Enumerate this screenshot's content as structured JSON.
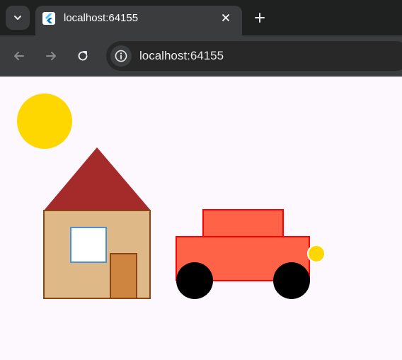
{
  "browser": {
    "tab": {
      "title": "localhost:64155"
    },
    "address_bar": {
      "url": "localhost:64155"
    }
  },
  "scene": {
    "colors": {
      "sun": "#FFD700",
      "roof": "#A52A2A",
      "house_wall": "#DEB887",
      "house_outline": "#8B4513",
      "window_frame": "#4A90E2",
      "window_glass": "#FFFFFF",
      "door": "#CD853F",
      "car_body": "#FF6347",
      "car_outline": "#FF0000",
      "wheel": "#000000",
      "headlight": "#FFD700",
      "background": "#FDF7FE"
    }
  }
}
